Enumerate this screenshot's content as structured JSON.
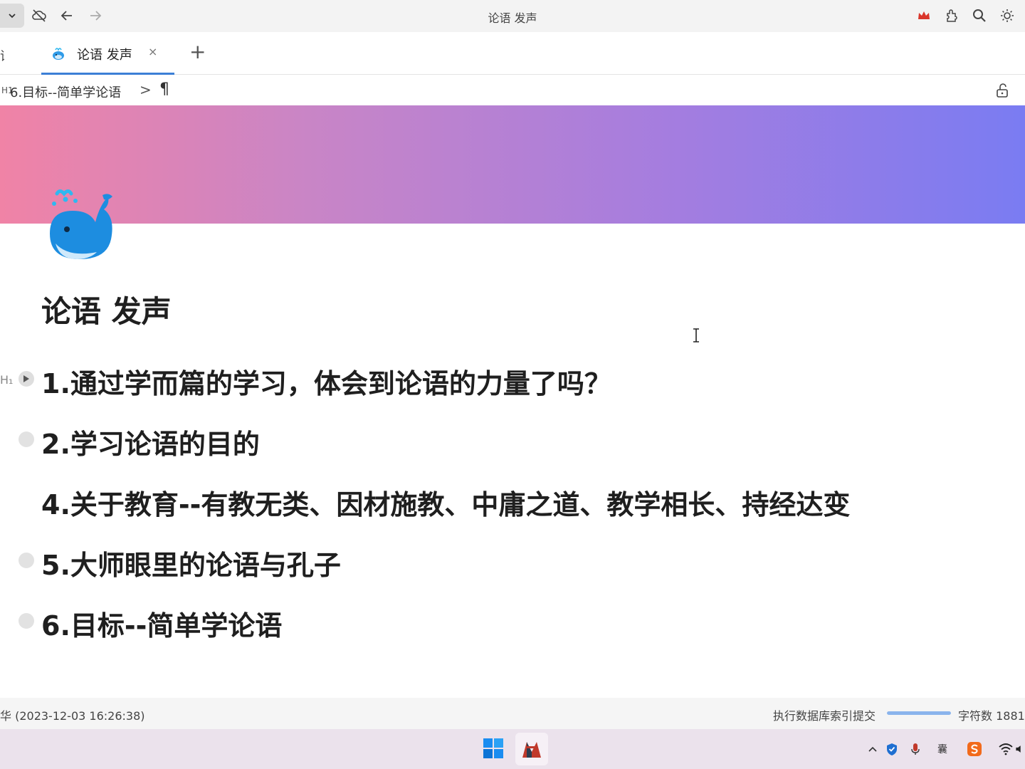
{
  "window": {
    "title": "论语 发声"
  },
  "toolbar": {
    "icons": [
      "chevron-down-icon",
      "cloud-off-icon",
      "back-arrow-icon",
      "forward-arrow-icon",
      "crown-icon",
      "plugin-icon",
      "search-icon",
      "theme-sun-icon"
    ]
  },
  "tabs": {
    "cut_label": "语",
    "active": {
      "label": "论语 发声",
      "close": "×"
    },
    "add_label": "+"
  },
  "breadcrumb": {
    "level": "H1",
    "path": "6.目标--简单学论语",
    "separator": ">",
    "pilcrow": "¶"
  },
  "document": {
    "title": "论语 发声",
    "heading_marker": "H₁",
    "headings": [
      "1.通过学而篇的学习，体会到论语的力量了吗？",
      "2.学习论语的目的",
      "4.关于教育--有教无类、因材施教、中庸之道、教学相长、持经达变",
      "5.大师眼里的论语与孔子",
      "6.目标--简单学论语"
    ]
  },
  "statusbar": {
    "left_text": "华 (2023-12-03 16:26:38)",
    "task": "执行数据库索引提交",
    "progress": 1.0,
    "char_count": "字符数 1881"
  },
  "taskbar": {
    "tray_ime": "囊",
    "tray_icons": [
      "chevron-up-icon",
      "shield-icon",
      "microphone-icon",
      "ime-icon",
      "sogou-icon",
      "wifi-icon",
      "speaker-icon"
    ]
  },
  "colors": {
    "accent": "#3c7fd6",
    "banner_start": "#f083a6",
    "banner_end": "#7a7cf2",
    "crown": "#d9362b"
  }
}
